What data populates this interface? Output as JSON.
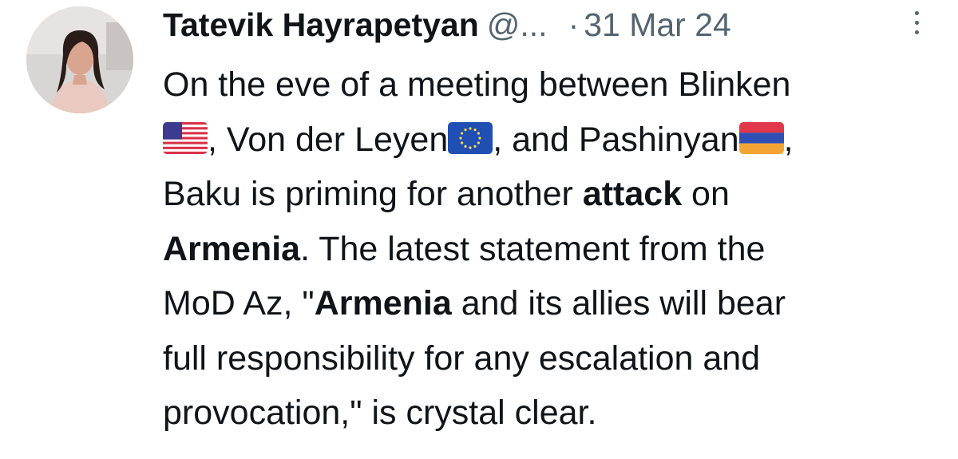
{
  "tweet": {
    "author_name": "Tatevik Hayrapetyan",
    "handle": "@...",
    "separator": "·",
    "date": "31 Mar 24",
    "lines": {
      "l1": {
        "a": "On the eve of a meeting between Blinken"
      },
      "l2": {
        "a": ", Von der Leyen",
        "b": ", and Pashinyan",
        "c": ","
      },
      "l3": {
        "a": "Baku is priming for another ",
        "b": "attack",
        "c": " on"
      },
      "l4": {
        "a": "Armenia",
        "b": ". The latest statement from the"
      },
      "l5": {
        "a": "MoD Az, \"",
        "b": "Armenia",
        "c": " and its allies will bear"
      },
      "l6": {
        "a": "full responsibility for any escalation and"
      },
      "l7": {
        "a": "provocation,\" is crystal clear."
      }
    },
    "icons": {
      "avatar": "avatar",
      "more": "more-icon",
      "flag_us": "flag-us-icon",
      "flag_eu": "flag-eu-icon",
      "flag_am": "flag-am-icon"
    }
  }
}
